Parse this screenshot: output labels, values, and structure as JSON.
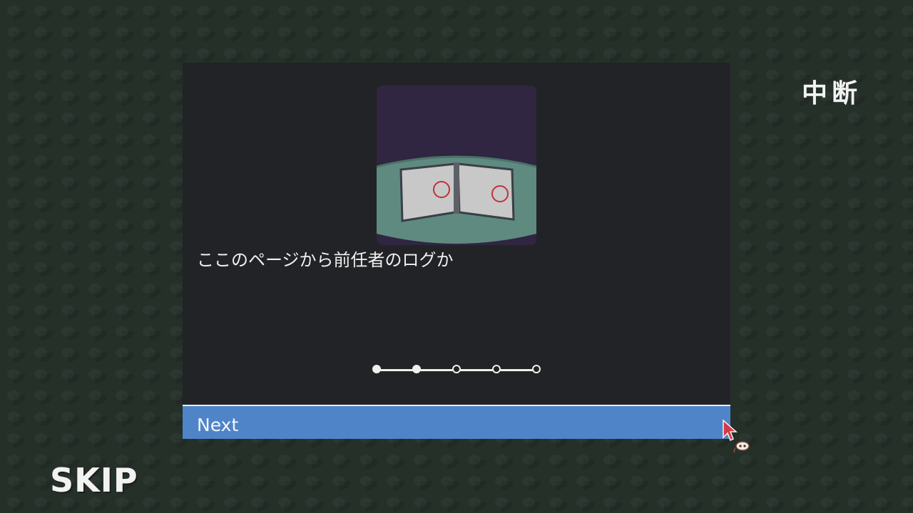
{
  "hud": {
    "pause_label": "中断",
    "skip_label": "SKIP"
  },
  "dialog": {
    "illustration_icon": "open-book-on-table",
    "message": "ここのページから前任者のログか",
    "progress": {
      "total": 5,
      "current": 2
    },
    "next_label": "Next"
  },
  "colors": {
    "background": "#253029",
    "panel": "#222326",
    "accent": "#4f84c8",
    "illustration_bg": "#302641",
    "table": "#5f8a80",
    "page": "#c8c8c8",
    "circle_mark": "#c0303a"
  }
}
